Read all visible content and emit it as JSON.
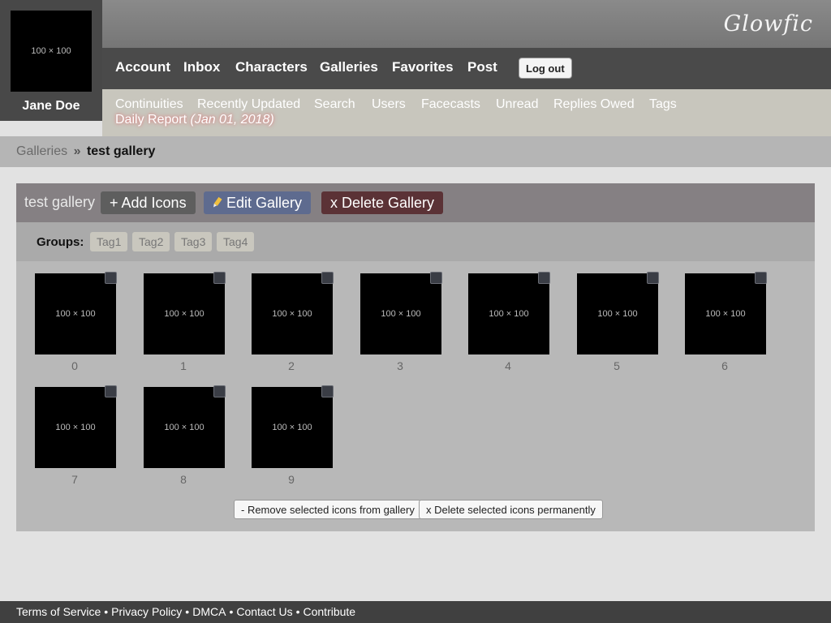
{
  "header": {
    "logo": "Glowfic",
    "nav": [
      "Account",
      "Inbox",
      "Characters",
      "Galleries",
      "Favorites",
      "Post"
    ],
    "logout_label": "Log out",
    "subnav": [
      "Continuities",
      "Recently Updated",
      "Search",
      "Users",
      "Facecasts",
      "Unread",
      "Replies Owed",
      "Tags"
    ],
    "daily_report_label": "Daily Report",
    "daily_report_date": "(Jan 01, 2018)"
  },
  "user": {
    "avatar_text": "100 × 100",
    "name": "Jane Doe"
  },
  "breadcrumb": {
    "parent": "Galleries",
    "separator": "»",
    "current": "test gallery"
  },
  "gallery": {
    "title": "test gallery",
    "add_icons_label": "+ Add Icons",
    "edit_label": "Edit Gallery",
    "delete_label": "x Delete Gallery",
    "groups_label": "Groups:",
    "tags": [
      "Tag1",
      "Tag2",
      "Tag3",
      "Tag4"
    ],
    "icons": [
      {
        "label": "0",
        "placeholder": "100 × 100"
      },
      {
        "label": "1",
        "placeholder": "100 × 100"
      },
      {
        "label": "2",
        "placeholder": "100 × 100"
      },
      {
        "label": "3",
        "placeholder": "100 × 100"
      },
      {
        "label": "4",
        "placeholder": "100 × 100"
      },
      {
        "label": "5",
        "placeholder": "100 × 100"
      },
      {
        "label": "6",
        "placeholder": "100 × 100"
      },
      {
        "label": "7",
        "placeholder": "100 × 100"
      },
      {
        "label": "8",
        "placeholder": "100 × 100"
      },
      {
        "label": "9",
        "placeholder": "100 × 100"
      }
    ],
    "remove_selected_label": "- Remove selected icons from gallery",
    "delete_selected_label": "x Delete selected icons permanently"
  },
  "footer": {
    "links": [
      "Terms of Service",
      "Privacy Policy",
      "DMCA",
      "Contact Us",
      "Contribute"
    ],
    "separator": "•"
  },
  "colors": {
    "nav_bg": "#4a4a4a",
    "subnav_bg": "#c8c6bd",
    "edit_button": "#5e6b8f",
    "delete_button": "#5b3236",
    "footer_bg": "#404040"
  }
}
